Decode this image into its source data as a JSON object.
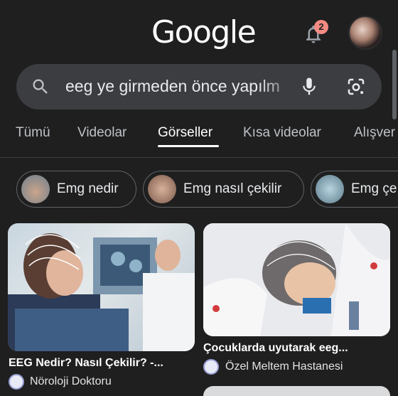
{
  "header": {
    "logo_text": "Google",
    "notification_count": "2"
  },
  "search": {
    "query": "eeg ye girmeden önce yapılm"
  },
  "tabs": [
    {
      "label": "Tümü"
    },
    {
      "label": "Videolar"
    },
    {
      "label": "Görseller"
    },
    {
      "label": "Kısa videolar"
    },
    {
      "label": "Alışver"
    }
  ],
  "active_tab": "Görseller",
  "chips": [
    {
      "label": "Emg nedir"
    },
    {
      "label": "Emg nasıl çekilir"
    },
    {
      "label": "Emg çe"
    }
  ],
  "results": [
    {
      "title": "EEG Nedir? Nasıl Çekilir? -...",
      "source": "Nöroloji Doktoru"
    },
    {
      "title": "Çocuklarda uyutarak eeg...",
      "source": "Özel Meltem Hastanesi"
    }
  ],
  "colors": {
    "background": "#1f1f1f",
    "search_bg": "#3c3d40",
    "badge": "#f28b82"
  }
}
